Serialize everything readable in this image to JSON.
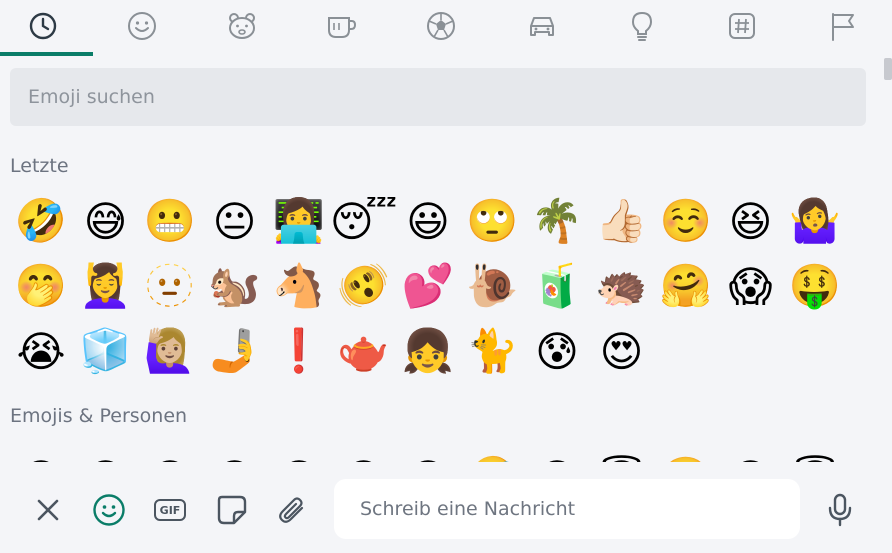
{
  "tabs": [
    {
      "icon": "clock-icon",
      "name": "tab-recent"
    },
    {
      "icon": "smiley-icon",
      "name": "tab-smileys"
    },
    {
      "icon": "bear-icon",
      "name": "tab-animals"
    },
    {
      "icon": "cup-icon",
      "name": "tab-food"
    },
    {
      "icon": "soccer-ball-icon",
      "name": "tab-activities"
    },
    {
      "icon": "car-icon",
      "name": "tab-travel"
    },
    {
      "icon": "lightbulb-icon",
      "name": "tab-objects"
    },
    {
      "icon": "hashtag-icon",
      "name": "tab-symbols"
    },
    {
      "icon": "flag-icon",
      "name": "tab-flags"
    }
  ],
  "colors": {
    "accent": "#0a7d68",
    "background": "#f4f5f8",
    "search_bg": "#e6e8ec",
    "muted_text": "#6c7380"
  },
  "search": {
    "placeholder": "Emoji suchen"
  },
  "sections": {
    "recent_title": "Letzte",
    "people_title": "Emojis & Personen"
  },
  "recent_emojis": [
    "🤣",
    "😅",
    "😬",
    "😐",
    "👩‍💻",
    "😴",
    "😃",
    "🙄",
    "🌴",
    "👍🏻",
    "☺️",
    "😆",
    "🤷‍♀️",
    "🤭",
    "💆‍♀️",
    "🫥",
    "🐿️",
    "🐴",
    "🫨",
    "💕",
    "🐌",
    "🧃",
    "🦔",
    "🤗",
    "😱",
    "🤑",
    "😭",
    "🧊",
    "🙋🏼‍♀️",
    "🤳",
    "❗",
    "🫖",
    "👧",
    "🐈",
    "😰",
    "😍"
  ],
  "people_emojis_partial": [
    "😀",
    "😃",
    "😄",
    "😁",
    "😆",
    "😅",
    "😂",
    "🤣",
    "😊",
    "😇",
    "🙂",
    "🙃",
    "😇"
  ],
  "bottom": {
    "close_icon": "close-icon",
    "emoji_icon": "smiley-icon",
    "gif_label": "GIF",
    "sticker_icon": "sticker-icon",
    "attach_icon": "paperclip-icon",
    "message_placeholder": "Schreib eine Nachricht",
    "mic_icon": "microphone-icon"
  }
}
